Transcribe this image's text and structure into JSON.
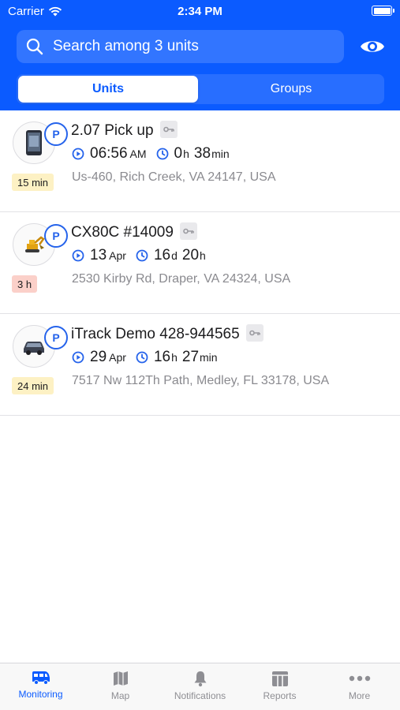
{
  "status_bar": {
    "carrier": "Carrier",
    "time": "2:34 PM"
  },
  "search": {
    "placeholder": "Search among 3 units"
  },
  "tabs": {
    "units": "Units",
    "groups": "Groups"
  },
  "units": [
    {
      "name": "2.07 Pick up",
      "badge": "P",
      "age": "15 min",
      "age_color": "#fdf1c4",
      "time_value": "06:56",
      "time_unit": "AM",
      "duration": [
        {
          "v": "0",
          "u": "h"
        },
        {
          "v": "38",
          "u": "min"
        }
      ],
      "address": "Us-460, Rich Creek, VA 24147, USA"
    },
    {
      "name": "CX80C #14009",
      "badge": "P",
      "age": "3 h",
      "age_color": "#fbd0c9",
      "time_value": "13",
      "time_unit": "Apr",
      "duration": [
        {
          "v": "16",
          "u": "d"
        },
        {
          "v": "20",
          "u": "h"
        }
      ],
      "address": "2530 Kirby Rd, Draper, VA 24324, USA"
    },
    {
      "name": "iTrack Demo 428-944565",
      "badge": "P",
      "age": "24 min",
      "age_color": "#fdf1c4",
      "time_value": "29",
      "time_unit": "Apr",
      "duration": [
        {
          "v": "16",
          "u": "h"
        },
        {
          "v": "27",
          "u": "min"
        }
      ],
      "address": "7517 Nw 112Th Path, Medley, FL 33178, USA"
    }
  ],
  "tabbar": [
    {
      "label": "Monitoring",
      "icon": "bus-icon",
      "active": true
    },
    {
      "label": "Map",
      "icon": "map-icon",
      "active": false
    },
    {
      "label": "Notifications",
      "icon": "bell-icon",
      "active": false
    },
    {
      "label": "Reports",
      "icon": "reports-icon",
      "active": false
    },
    {
      "label": "More",
      "icon": "more-icon",
      "active": false
    }
  ],
  "colors": {
    "accent": "#0b5bff",
    "badge": "#2563eb"
  }
}
